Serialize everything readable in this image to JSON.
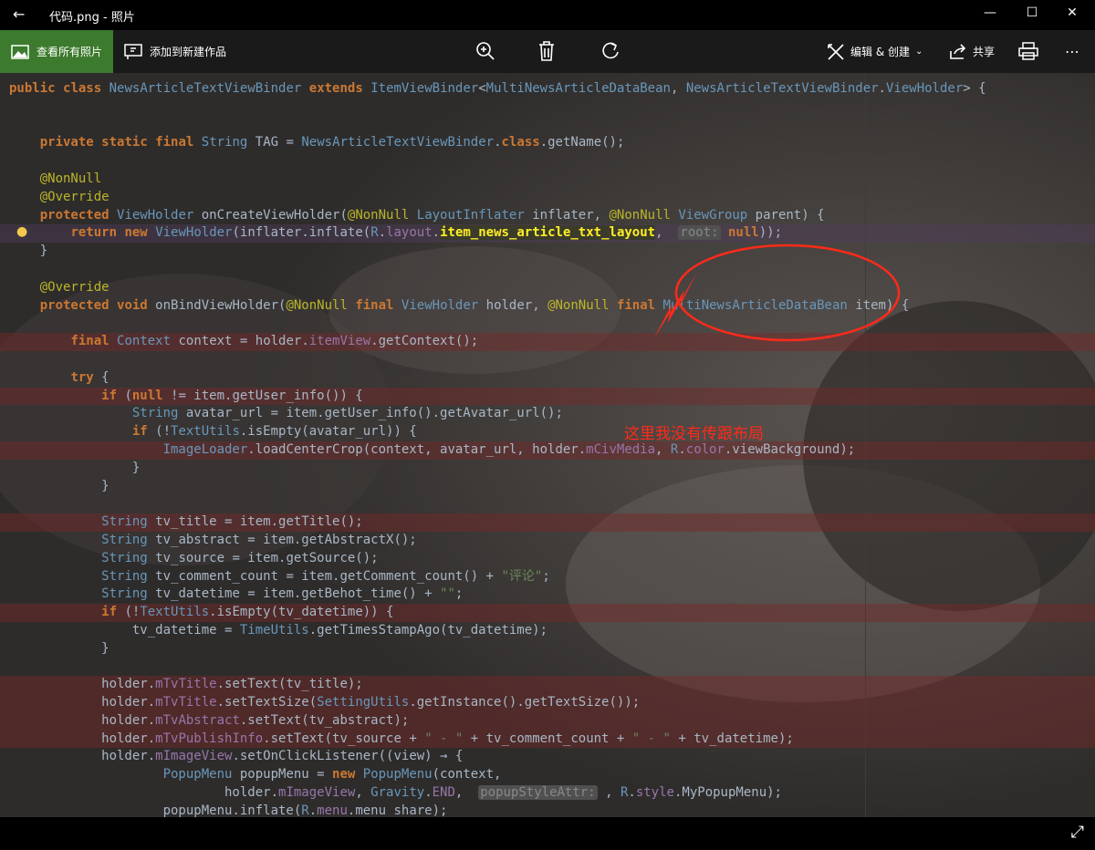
{
  "window": {
    "title": "代码.png - 照片",
    "back_icon": "arrow-left-icon"
  },
  "toolbar": {
    "view_all_label": "查看所有照片",
    "add_creation_label": "添加到新建作品",
    "edit_create_label": "编辑 & 创建",
    "share_label": "共享",
    "accent_color": "#3c7a2d"
  },
  "code_lines": [
    {
      "t": "public class NewsArticleTextViewBinder extends ItemViewBinder<MultiNewsArticleDataBean, NewsArticleTextViewBinder.ViewHolder> {"
    },
    {
      "t": ""
    },
    {
      "t": ""
    },
    {
      "t": "    private static final String TAG = NewsArticleTextViewBinder.class.getName();"
    },
    {
      "t": ""
    },
    {
      "t": "    @NonNull"
    },
    {
      "t": "    @Override"
    },
    {
      "t": "    protected ViewHolder onCreateViewHolder(@NonNull LayoutInflater inflater, @NonNull ViewGroup parent) {"
    },
    {
      "t": "        return new ViewHolder(inflater.inflate(R.layout.item_news_article_txt_layout,  root: null));"
    },
    {
      "t": "    }"
    },
    {
      "t": ""
    },
    {
      "t": "    @Override"
    },
    {
      "t": "    protected void onBindViewHolder(@NonNull final ViewHolder holder, @NonNull final MultiNewsArticleDataBean item) {"
    },
    {
      "t": ""
    },
    {
      "t": "        final Context context = holder.itemView.getContext();"
    },
    {
      "t": ""
    },
    {
      "t": "        try {"
    },
    {
      "t": "            if (null != item.getUser_info()) {"
    },
    {
      "t": "                String avatar_url = item.getUser_info().getAvatar_url();"
    },
    {
      "t": "                if (!TextUtils.isEmpty(avatar_url)) {"
    },
    {
      "t": "                    ImageLoader.loadCenterCrop(context, avatar_url, holder.mCivMedia, R.color.viewBackground);"
    },
    {
      "t": "                }"
    },
    {
      "t": "            }"
    },
    {
      "t": ""
    },
    {
      "t": "            String tv_title = item.getTitle();"
    },
    {
      "t": "            String tv_abstract = item.getAbstractX();"
    },
    {
      "t": "            String tv_source = item.getSource();"
    },
    {
      "t": "            String tv_comment_count = item.getComment_count() + \"评论\";"
    },
    {
      "t": "            String tv_datetime = item.getBehot_time() + \"\";"
    },
    {
      "t": "            if (!TextUtils.isEmpty(tv_datetime)) {"
    },
    {
      "t": "                tv_datetime = TimeUtils.getTimesStampAgo(tv_datetime);"
    },
    {
      "t": "            }"
    },
    {
      "t": ""
    },
    {
      "t": "            holder.mTvTitle.setText(tv_title);"
    },
    {
      "t": "            holder.mTvTitle.setTextSize(SettingUtils.getInstance().getTextSize());"
    },
    {
      "t": "            holder.mTvAbstract.setText(tv_abstract);"
    },
    {
      "t": "            holder.mTvPublishInfo.setText(tv_source + \" - \" + tv_comment_count + \" - \" + tv_datetime);"
    },
    {
      "t": "            holder.mImageView.setOnClickListener((view) → {"
    },
    {
      "t": "                    PopupMenu popupMenu = new PopupMenu(context,"
    },
    {
      "t": "                            holder.mImageView, Gravity.END,  popupStyleAttr: 0, R.style.MyPopupMenu);"
    },
    {
      "t": "                    popupMenu.inflate(R.menu.menu_share);"
    }
  ],
  "annotation": {
    "note_text": "这里我没有传跟布局",
    "color": "#ff2a1a"
  }
}
